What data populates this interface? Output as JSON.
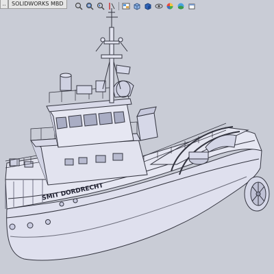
{
  "app": {
    "tabs": [
      {
        "label": "..",
        "active": false
      },
      {
        "label": "SOLIDWORKS MBD",
        "active": true
      }
    ]
  },
  "heads_up_toolbar": {
    "icons": [
      "zoom-to-fit-icon",
      "zoom-area-icon",
      "previous-view-icon",
      "section-view-icon",
      "view-selector-icon",
      "view-orientation-icon",
      "display-style-icon",
      "hide-show-items-icon",
      "edit-appearance-icon",
      "apply-scene-icon",
      "view-settings-icon"
    ]
  },
  "model": {
    "hull_text": "SMIT DORDRECHT",
    "colors": {
      "background": "#c9ccd6",
      "model_fill": "#dfe0ee",
      "edge_line": "#33343f"
    }
  }
}
